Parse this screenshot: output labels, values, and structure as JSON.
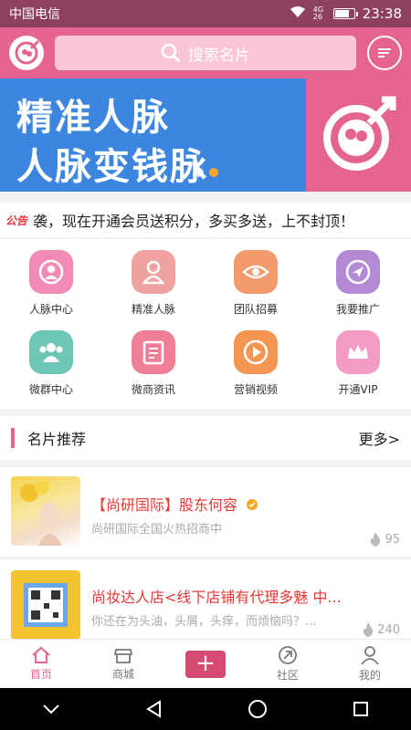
{
  "status": {
    "carrier": "中国电信",
    "network": "4G 26",
    "time": "23:38"
  },
  "header": {
    "search_placeholder": "搜索名片"
  },
  "banner": {
    "line1": "精准人脉",
    "line2": "人脉变钱脉",
    "active_dot": 2
  },
  "notice": {
    "tag": "公告",
    "text": "袭，现在开通会员送积分，多买多送，上不封顶！"
  },
  "grid": [
    {
      "label": "人脉中心",
      "icon": "person-circle-icon",
      "color": "#f08cb5"
    },
    {
      "label": "精准人脉",
      "icon": "person-icon",
      "color": "#f0a2a0"
    },
    {
      "label": "团队招募",
      "icon": "eye-icon",
      "color": "#f39b6d"
    },
    {
      "label": "我要推广",
      "icon": "compass-icon",
      "color": "#b48ad4"
    },
    {
      "label": "微群中心",
      "icon": "group-icon",
      "color": "#6ec6b4"
    },
    {
      "label": "微商资讯",
      "icon": "news-icon",
      "color": "#ef7f96"
    },
    {
      "label": "营销视频",
      "icon": "play-icon",
      "color": "#f59552"
    },
    {
      "label": "开通VIP",
      "icon": "crown-icon",
      "color": "#f49bc4"
    }
  ],
  "section": {
    "title": "名片推荐",
    "more": "更多>"
  },
  "cards": [
    {
      "name": "【尚研国际】股东何容",
      "desc": "尚研国际全国火热招商中",
      "heat": "95",
      "verified": true
    },
    {
      "name": "尚妆达人店<线下店铺有代理多魅 中...",
      "desc": "你还在为头油，头屑，头痒，而烦恼吗？...",
      "heat": "240",
      "verified": false
    }
  ],
  "tabs": [
    {
      "label": "首页",
      "icon": "home-icon",
      "active": true
    },
    {
      "label": "商城",
      "icon": "shop-icon",
      "active": false
    },
    {
      "label": "+",
      "icon": "plus-icon",
      "active": false
    },
    {
      "label": "社区",
      "icon": "community-icon",
      "active": false
    },
    {
      "label": "我的",
      "icon": "user-icon",
      "active": false
    }
  ]
}
